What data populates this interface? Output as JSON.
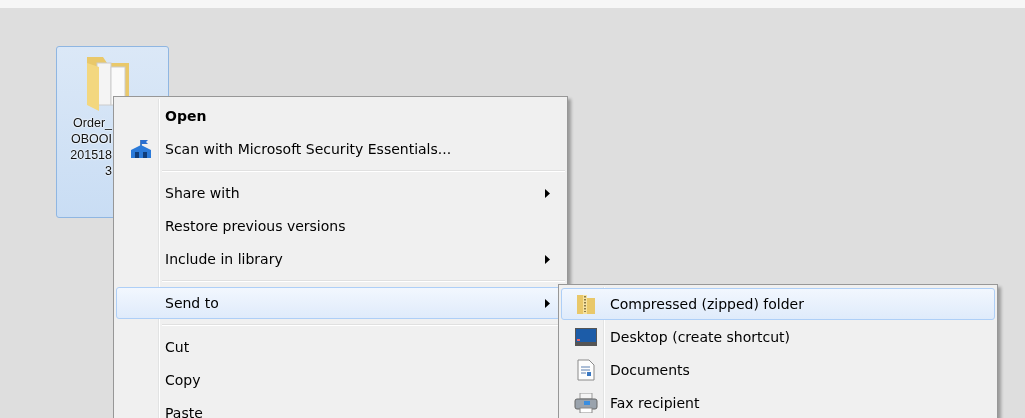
{
  "desktop_icon": {
    "label_lines": [
      "Order_",
      "OBOOI",
      "201518",
      "3"
    ],
    "selected": true
  },
  "context_menu": {
    "groups": [
      [
        {
          "label": "Open",
          "default": true,
          "has_submenu": false,
          "selected": false
        },
        {
          "label": "Scan with Microsoft Security Essentials...",
          "default": false,
          "has_submenu": false,
          "selected": false
        }
      ],
      [
        {
          "label": "Share with",
          "default": false,
          "has_submenu": true,
          "selected": false
        },
        {
          "label": "Restore previous versions",
          "default": false,
          "has_submenu": false,
          "selected": false
        },
        {
          "label": "Include in library",
          "default": false,
          "has_submenu": true,
          "selected": false
        }
      ],
      [
        {
          "label": "Send to",
          "default": false,
          "has_submenu": true,
          "selected": true
        }
      ],
      [
        {
          "label": "Cut",
          "default": false,
          "has_submenu": false,
          "selected": false
        },
        {
          "label": "Copy",
          "default": false,
          "has_submenu": false,
          "selected": false
        },
        {
          "label": "Paste",
          "default": false,
          "has_submenu": false,
          "selected": false
        }
      ]
    ]
  },
  "send_to_menu": {
    "items": [
      {
        "label": "Compressed (zipped) folder",
        "selected": true
      },
      {
        "label": "Desktop (create shortcut)",
        "selected": false
      },
      {
        "label": "Documents",
        "selected": false
      },
      {
        "label": "Fax recipient",
        "selected": false
      }
    ]
  }
}
